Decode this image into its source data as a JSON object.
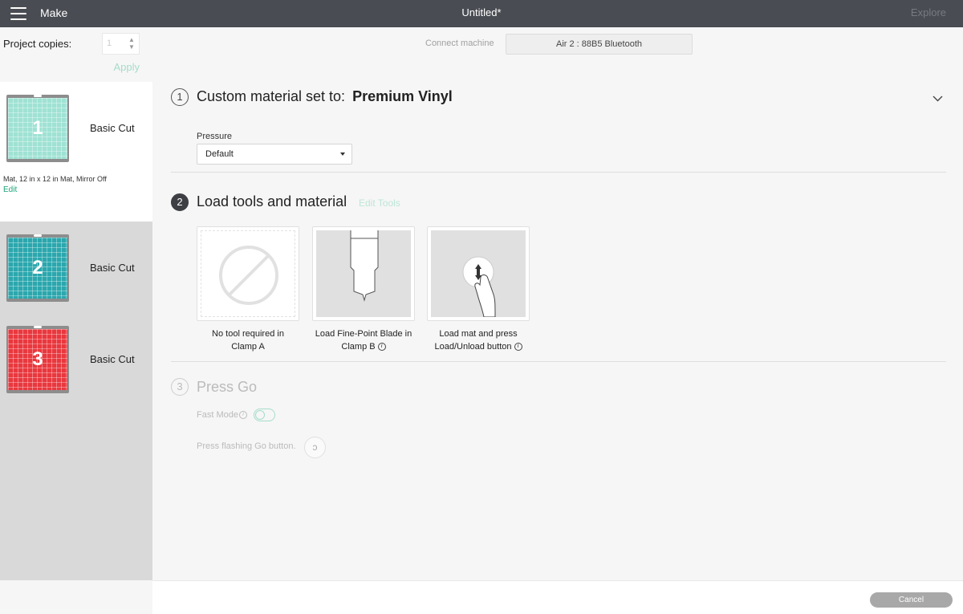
{
  "topbar": {
    "app_name": "Make",
    "document_title": "Untitled*",
    "explore_label": "Explore"
  },
  "sidebar": {
    "copies_label": "Project copies:",
    "copies_value": "1",
    "apply_label": "Apply",
    "mats": [
      {
        "number": "1",
        "label": "Basic Cut",
        "color": "#9fe2d4",
        "info": "Mat, 12 in x 12 in Mat, Mirror Off",
        "edit_label": "Edit"
      },
      {
        "number": "2",
        "label": "Basic Cut",
        "color": "#2ba7ad"
      },
      {
        "number": "3",
        "label": "Basic Cut",
        "color": "#e8383e"
      }
    ]
  },
  "main": {
    "connect_label": "Connect machine",
    "machine_name": "Air 2 : 88B5 Bluetooth",
    "step1": {
      "number": "1",
      "title_prefix": "Custom material set to:",
      "material": "Premium Vinyl",
      "pressure_label": "Pressure",
      "pressure_value": "Default"
    },
    "step2": {
      "number": "2",
      "title": "Load tools and material",
      "edit_tools_label": "Edit Tools",
      "tools": [
        {
          "line1": "No tool required in",
          "line2": "Clamp A"
        },
        {
          "line1": "Load Fine-Point Blade in",
          "line2": "Clamp B"
        },
        {
          "line1": "Load mat and press",
          "line2": "Load/Unload button"
        }
      ]
    },
    "step3": {
      "number": "3",
      "title": "Press Go",
      "fast_mode_label": "Fast Mode",
      "instruction": "Press flashing Go button."
    }
  },
  "footer": {
    "cancel_label": "Cancel"
  }
}
